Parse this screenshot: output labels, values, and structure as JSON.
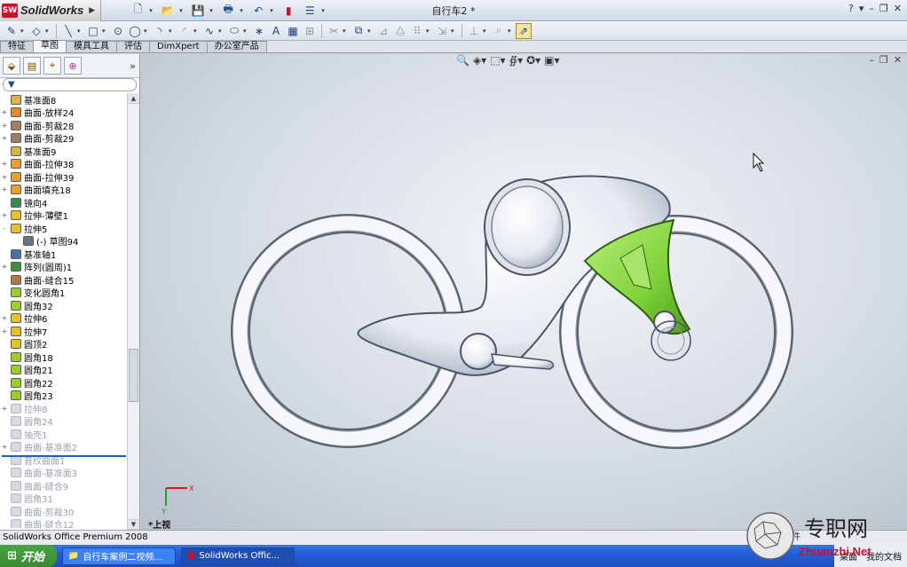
{
  "app": {
    "logo_mark": "SW",
    "logo_text": "SolidWorks",
    "document_title": "自行车2 *",
    "help": "?"
  },
  "tabs": [
    {
      "label": "特征",
      "active": false
    },
    {
      "label": "草图",
      "active": true
    },
    {
      "label": "模具工具",
      "active": false
    },
    {
      "label": "评估",
      "active": false
    },
    {
      "label": "DimXpert",
      "active": false
    },
    {
      "label": "办公室产品",
      "active": false
    }
  ],
  "tree": [
    {
      "label": "基准面8",
      "expand": "",
      "icon": "plane",
      "suppressed": false,
      "indent": 0
    },
    {
      "label": "曲面-放样24",
      "expand": "+",
      "icon": "surface-loft",
      "suppressed": false,
      "indent": 0
    },
    {
      "label": "曲面-剪裁28",
      "expand": "+",
      "icon": "surface-trim",
      "suppressed": false,
      "indent": 0
    },
    {
      "label": "曲面-剪裁29",
      "expand": "+",
      "icon": "surface-trim",
      "suppressed": false,
      "indent": 0
    },
    {
      "label": "基准面9",
      "expand": "",
      "icon": "plane",
      "suppressed": false,
      "indent": 0
    },
    {
      "label": "曲面-拉伸38",
      "expand": "+",
      "icon": "surface-extrude",
      "suppressed": false,
      "indent": 0
    },
    {
      "label": "曲面-拉伸39",
      "expand": "+",
      "icon": "surface-extrude",
      "suppressed": false,
      "indent": 0
    },
    {
      "label": "曲面填充18",
      "expand": "+",
      "icon": "surface-fill",
      "suppressed": false,
      "indent": 0
    },
    {
      "label": "镜向4",
      "expand": "",
      "icon": "mirror",
      "suppressed": false,
      "indent": 0
    },
    {
      "label": "拉伸-薄壁1",
      "expand": "+",
      "icon": "extrude-thin",
      "suppressed": false,
      "indent": 0
    },
    {
      "label": "拉伸5",
      "expand": "-",
      "icon": "extrude",
      "suppressed": false,
      "indent": 0
    },
    {
      "label": "(-) 草图94",
      "expand": "",
      "icon": "sketch",
      "suppressed": false,
      "indent": 1
    },
    {
      "label": "基准轴1",
      "expand": "",
      "icon": "axis",
      "suppressed": false,
      "indent": 0
    },
    {
      "label": "阵列(圆周)1",
      "expand": "+",
      "icon": "pattern",
      "suppressed": false,
      "indent": 0
    },
    {
      "label": "曲面-缝合15",
      "expand": "",
      "icon": "knit",
      "suppressed": false,
      "indent": 0
    },
    {
      "label": "变化圆角1",
      "expand": "",
      "icon": "fillet",
      "suppressed": false,
      "indent": 0
    },
    {
      "label": "圆角32",
      "expand": "",
      "icon": "fillet",
      "suppressed": false,
      "indent": 0
    },
    {
      "label": "拉伸6",
      "expand": "+",
      "icon": "extrude",
      "suppressed": false,
      "indent": 0
    },
    {
      "label": "拉伸7",
      "expand": "+",
      "icon": "extrude",
      "suppressed": false,
      "indent": 0
    },
    {
      "label": "圆顶2",
      "expand": "",
      "icon": "dome",
      "suppressed": false,
      "indent": 0
    },
    {
      "label": "圆角18",
      "expand": "",
      "icon": "fillet",
      "suppressed": false,
      "indent": 0
    },
    {
      "label": "圆角21",
      "expand": "",
      "icon": "fillet",
      "suppressed": false,
      "indent": 0
    },
    {
      "label": "圆角22",
      "expand": "",
      "icon": "fillet",
      "suppressed": false,
      "indent": 0
    },
    {
      "label": "圆角23",
      "expand": "",
      "icon": "fillet",
      "suppressed": false,
      "indent": 0
    },
    {
      "label": "拉伸8",
      "expand": "+",
      "icon": "extrude",
      "suppressed": true,
      "indent": 0
    },
    {
      "label": "圆角24",
      "expand": "",
      "icon": "fillet",
      "suppressed": true,
      "indent": 0
    },
    {
      "label": "抽壳1",
      "expand": "",
      "icon": "shell",
      "suppressed": true,
      "indent": 0
    },
    {
      "label": "曲面-基准面2",
      "expand": "+",
      "icon": "surface-plane",
      "suppressed": true,
      "indent": 0
    },
    {
      "label": "直纹曲面1",
      "expand": "",
      "icon": "ruled",
      "suppressed": true,
      "indent": 0
    },
    {
      "label": "曲面-基准面3",
      "expand": "",
      "icon": "surface-plane",
      "suppressed": true,
      "indent": 0
    },
    {
      "label": "曲面-缝合9",
      "expand": "",
      "icon": "knit",
      "suppressed": true,
      "indent": 0
    },
    {
      "label": "圆角31",
      "expand": "",
      "icon": "fillet",
      "suppressed": true,
      "indent": 0
    },
    {
      "label": "曲面-剪裁30",
      "expand": "",
      "icon": "surface-trim",
      "suppressed": true,
      "indent": 0
    },
    {
      "label": "曲面-缝合12",
      "expand": "",
      "icon": "knit",
      "suppressed": true,
      "indent": 0
    }
  ],
  "viewport": {
    "view_label": "*上视",
    "triad_x": "X",
    "triad_y": "Y"
  },
  "status": {
    "left": "SolidWorks Office Premium 2008",
    "right": "件"
  },
  "taskbar": {
    "start": "开始",
    "tasks": [
      {
        "label": "自行车案例二视频...",
        "active": false,
        "icon": "folder-icon"
      },
      {
        "label": "SolidWorks Offic...",
        "active": true,
        "icon": "solidworks-icon"
      }
    ],
    "tray": [
      {
        "label": "桌面"
      },
      {
        "label": "我的文档"
      }
    ]
  },
  "watermark": {
    "title": "专职网",
    "url": "Zhuanzhi.Net"
  },
  "colors": {
    "accent": "#1d5cc5",
    "green_part": "#7fd23a",
    "body": "#f2f4f8"
  }
}
